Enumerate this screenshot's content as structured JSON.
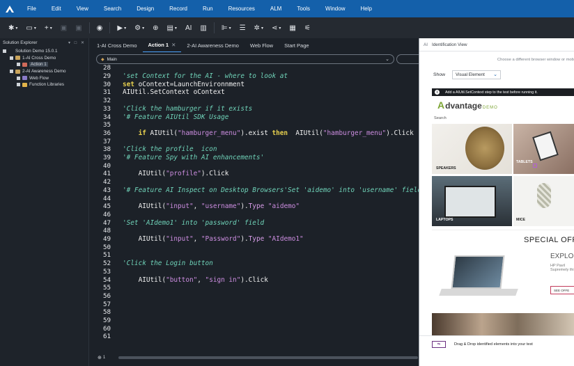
{
  "menu": [
    "File",
    "Edit",
    "View",
    "Search",
    "Design",
    "Record",
    "Run",
    "Resources",
    "ALM",
    "Tools",
    "Window",
    "Help"
  ],
  "toolbar": {
    "ai_label": "AI"
  },
  "explorer": {
    "title": "Solution Explorer",
    "controls": "▾ □ ✕",
    "items": [
      {
        "label": "Solution Demo 15.0.1",
        "icon": "solution-icon"
      },
      {
        "label": "1-AI Cross Demo",
        "icon": "test-icon"
      },
      {
        "label": "Action 1",
        "icon": "action-icon"
      },
      {
        "label": "2-AI Awareness Demo",
        "icon": "test-icon"
      },
      {
        "label": "Web Flow",
        "icon": "flow-icon"
      },
      {
        "label": "Function Libraries",
        "icon": "folder-icon"
      }
    ]
  },
  "tabs": [
    {
      "label": "1-AI Cross Demo"
    },
    {
      "label": "Action 1",
      "close": "✕"
    },
    {
      "label": "2-AI Awareness Demo"
    },
    {
      "label": "Web Flow"
    },
    {
      "label": "Start Page"
    }
  ],
  "editor": {
    "scope": "Main",
    "footer_zoom": "1",
    "lines": [
      {
        "n": "28",
        "tokens": []
      },
      {
        "n": "29",
        "tokens": [
          {
            "t": "'set Context for the AI - where to look at",
            "c": "cmt"
          }
        ]
      },
      {
        "n": "30",
        "tokens": [
          {
            "t": "set",
            "c": "kw"
          },
          {
            "t": " oContext=LaunchEnvironnment",
            "c": "id"
          }
        ]
      },
      {
        "n": "31",
        "tokens": [
          {
            "t": "AIUtil.SetContext oContext",
            "c": "id"
          }
        ]
      },
      {
        "n": "32",
        "tokens": []
      },
      {
        "n": "33",
        "tokens": [
          {
            "t": "'Click the hamburger if it exists",
            "c": "cmt"
          }
        ]
      },
      {
        "n": "34",
        "tokens": [
          {
            "t": "'# Feature AIUtil SDK Usage",
            "c": "cmt"
          }
        ]
      },
      {
        "n": "35",
        "tokens": []
      },
      {
        "n": "36",
        "tokens": [
          {
            "t": "    ",
            "c": "id"
          },
          {
            "t": "if",
            "c": "kw"
          },
          {
            "t": " AIUtil(",
            "c": "id"
          },
          {
            "t": "\"hamburger_menu\"",
            "c": "str"
          },
          {
            "t": ").exist ",
            "c": "id"
          },
          {
            "t": "then",
            "c": "kw"
          },
          {
            "t": "  AIUtil(",
            "c": "id"
          },
          {
            "t": "\"hamburger_menu\"",
            "c": "str"
          },
          {
            "t": ").Click",
            "c": "id"
          }
        ]
      },
      {
        "n": "37",
        "tokens": []
      },
      {
        "n": "38",
        "tokens": [
          {
            "t": "'Click the profile  icon",
            "c": "cmt"
          }
        ]
      },
      {
        "n": "39",
        "tokens": [
          {
            "t": "'# Feature Spy with AI enhancements'",
            "c": "cmt"
          }
        ]
      },
      {
        "n": "40",
        "tokens": []
      },
      {
        "n": "41",
        "tokens": [
          {
            "t": "    AIUtil(",
            "c": "id"
          },
          {
            "t": "\"profile\"",
            "c": "str"
          },
          {
            "t": ").Click",
            "c": "id"
          }
        ]
      },
      {
        "n": "42",
        "tokens": []
      },
      {
        "n": "43",
        "tokens": [
          {
            "t": "'# Feature AI Inspect on Desktop Browsers'Set 'aidemo' into 'username' field",
            "c": "cmt"
          }
        ]
      },
      {
        "n": "44",
        "tokens": []
      },
      {
        "n": "45",
        "tokens": [
          {
            "t": "    AIUtil(",
            "c": "id"
          },
          {
            "t": "\"input\"",
            "c": "str"
          },
          {
            "t": ", ",
            "c": "id"
          },
          {
            "t": "\"username\"",
            "c": "str"
          },
          {
            "t": ").",
            "c": "id"
          },
          {
            "t": "Type",
            "c": "meth"
          },
          {
            "t": " ",
            "c": "id"
          },
          {
            "t": "\"aidemo\"",
            "c": "str"
          }
        ]
      },
      {
        "n": "46",
        "tokens": []
      },
      {
        "n": "47",
        "tokens": [
          {
            "t": "'Set 'AIdemo1' into 'password' field",
            "c": "cmt"
          }
        ]
      },
      {
        "n": "48",
        "tokens": []
      },
      {
        "n": "49",
        "tokens": [
          {
            "t": "    AIUtil(",
            "c": "id"
          },
          {
            "t": "\"input\"",
            "c": "str"
          },
          {
            "t": ", ",
            "c": "id"
          },
          {
            "t": "\"Password\"",
            "c": "str"
          },
          {
            "t": ").",
            "c": "id"
          },
          {
            "t": "Type",
            "c": "meth"
          },
          {
            "t": " ",
            "c": "id"
          },
          {
            "t": "\"AIdemo1\"",
            "c": "str"
          }
        ]
      },
      {
        "n": "50",
        "tokens": []
      },
      {
        "n": "51",
        "tokens": []
      },
      {
        "n": "52",
        "tokens": [
          {
            "t": "'Click the Login button",
            "c": "cmt"
          }
        ]
      },
      {
        "n": "53",
        "tokens": []
      },
      {
        "n": "54",
        "tokens": [
          {
            "t": "    AIUtil(",
            "c": "id"
          },
          {
            "t": "\"button\"",
            "c": "str"
          },
          {
            "t": ", ",
            "c": "id"
          },
          {
            "t": "\"sign in\"",
            "c": "str"
          },
          {
            "t": ").Click",
            "c": "id"
          }
        ]
      },
      {
        "n": "55",
        "tokens": []
      },
      {
        "n": "56",
        "tokens": []
      },
      {
        "n": "57",
        "tokens": []
      },
      {
        "n": "58",
        "tokens": []
      },
      {
        "n": "59",
        "tokens": []
      },
      {
        "n": "60",
        "tokens": []
      },
      {
        "n": "61",
        "tokens": []
      }
    ]
  },
  "ai_panel": {
    "badge": "AI",
    "title": "Identification View",
    "subtitle": "Choose a different browser window or mob",
    "show_label": "Show",
    "show_value": "Visual Element",
    "info": "Add a AIUtil.SetContext step to the test before running it.",
    "footer": "Drag & Drop identified elements into your test",
    "shop": {
      "logo_mark": "A",
      "logo_text": "dvantage",
      "logo_demo": "DEMO",
      "search": "Search",
      "tiles": {
        "speakers": "SPEAKERS",
        "tablets": "TABLETS",
        "laptops": "LAPTOPS",
        "mice": "MICE"
      },
      "offer_title": "SPECIAL OFFE",
      "offer_explore": "EXPLOR",
      "offer_small_1": "HP Pavil",
      "offer_small_2": "Supremely thi",
      "offer_button": "SEE OFFE"
    }
  },
  "colors": {
    "menubar": "#1460aa",
    "comment": "#6fd2b8",
    "keyword": "#e7d04e",
    "string": "#cc8de0"
  }
}
